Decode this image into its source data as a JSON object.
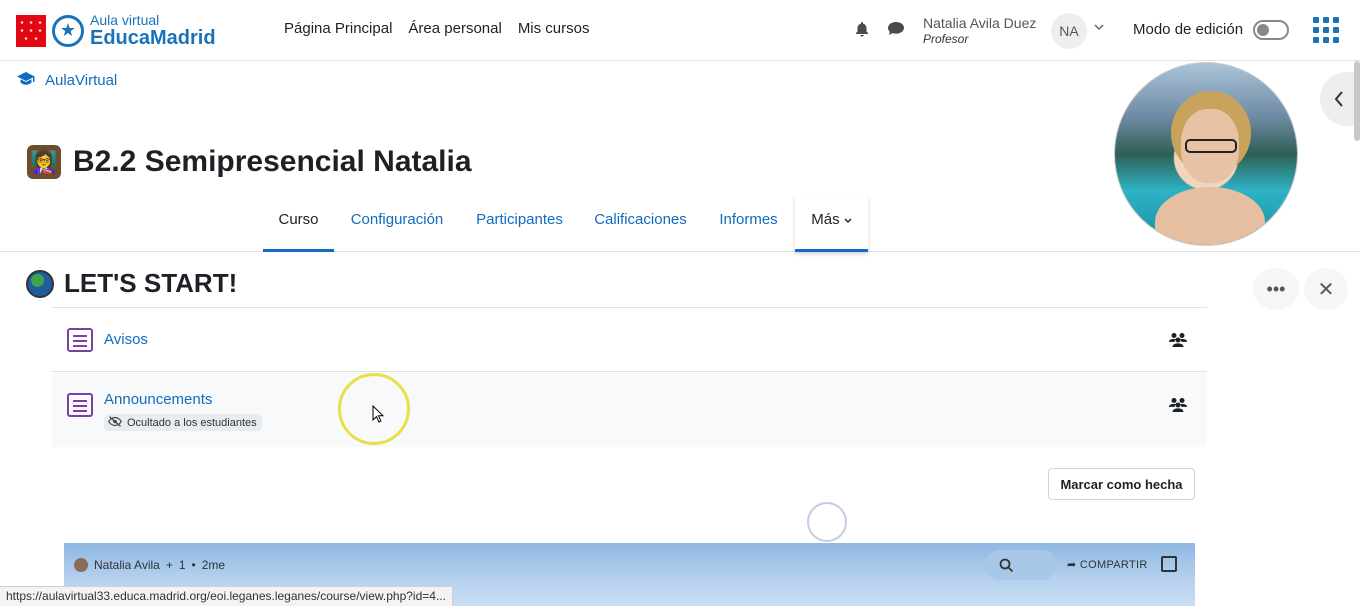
{
  "brand": {
    "line1": "Aula virtual",
    "line2": "EducaMadrid"
  },
  "nav": {
    "items": [
      "Página Principal",
      "Área personal",
      "Mis cursos"
    ]
  },
  "user": {
    "name": "Natalia Avila Duez",
    "role": "Profesor",
    "initials": "NA"
  },
  "edit_mode_label": "Modo de edición",
  "breadcrumb": "AulaVirtual",
  "course": {
    "title": "B2.2 Semipresencial Natalia",
    "tabs": [
      "Curso",
      "Configuración",
      "Participantes",
      "Calificaciones",
      "Informes",
      "Más"
    ]
  },
  "section": {
    "title": "LET'S START!",
    "activities": [
      {
        "title": "Avisos"
      },
      {
        "title": "Announcements",
        "badge": "Ocultado a los estudiantes"
      }
    ],
    "mark_done_label": "Marcar como hecha"
  },
  "embed": {
    "author": "Natalia Avila",
    "count": "1",
    "time": "2me",
    "share_label": "COMPARTIR"
  },
  "status_url": "https://aulavirtual33.educa.madrid.org/eoi.leganes.leganes/course/view.php?id=4..."
}
